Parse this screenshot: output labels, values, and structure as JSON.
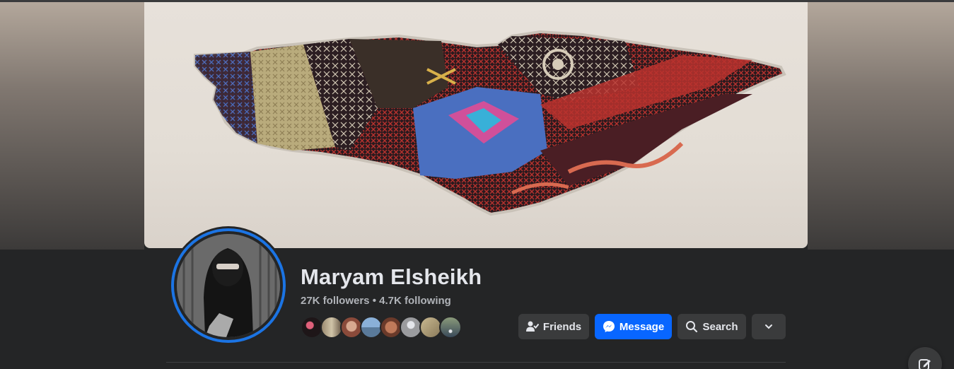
{
  "profile": {
    "name": "Maryam Elsheikh",
    "followers": "27K followers",
    "separator": "•",
    "following": "4.7K following"
  },
  "friends_preview": {
    "avatar_colors": [
      "#2a1f1f",
      "#8a7a66",
      "#a06a5a",
      "#6b8fb0",
      "#7a4a3a",
      "#9a9a9a",
      "#b0a080",
      "#4a5a70"
    ]
  },
  "actions": {
    "friends_label": "Friends",
    "message_label": "Message",
    "search_label": "Search"
  },
  "icons": {
    "friends": "friend-check-icon",
    "message": "messenger-icon",
    "search": "search-icon",
    "more": "chevron-down-icon",
    "edit": "edit-pencil-icon"
  },
  "colors": {
    "accent": "#0866ff",
    "avatar_ring": "#1b74e4",
    "button_bg": "#3a3b3c",
    "page_bg": "#242526"
  }
}
